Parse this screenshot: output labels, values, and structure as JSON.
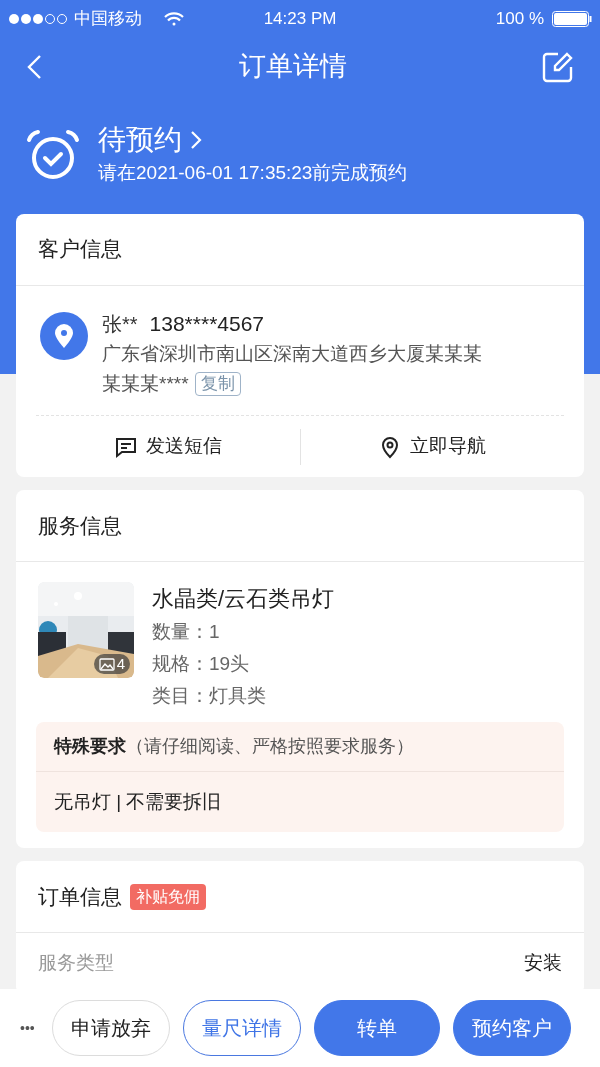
{
  "status_bar": {
    "carrier": "中国移动",
    "time": "14:23 PM",
    "battery": "100 %"
  },
  "nav": {
    "title": "订单详情"
  },
  "order_status": {
    "title": "待预约",
    "deadline": "请在2021-06-01 17:35:23前完成预约"
  },
  "customer": {
    "heading": "客户信息",
    "name": "张**",
    "phone": "138****4567",
    "address_lines": [
      "广东省深圳市南山区深南大道西乡大厦某某某",
      "某某某****"
    ],
    "copy": "复制",
    "actions": [
      {
        "kind": "sms",
        "label": "发送短信"
      },
      {
        "kind": "navigate",
        "label": "立即导航"
      }
    ]
  },
  "service": {
    "heading": "服务信息",
    "photo": {
      "count": "4"
    },
    "product": "水晶类/云石类吊灯",
    "specs": [
      {
        "label": "数量：",
        "value": "1"
      },
      {
        "label": "规格：",
        "value": "19头"
      },
      {
        "label": "类目：",
        "value": "灯具类"
      }
    ],
    "requirement_title": "特殊要求",
    "requirement_hint": "（请仔细阅读、严格按照要求服务）",
    "requirement": "无吊灯 | 不需要拆旧"
  },
  "order": {
    "heading": "订单信息",
    "tag": "补贴免佣",
    "rows": [
      {
        "label": "服务类型",
        "value": "安装"
      }
    ]
  },
  "bottom_bar": {
    "more": "•••",
    "buttons": [
      {
        "kind": "plain",
        "label": "申请放弃"
      },
      {
        "kind": "outline",
        "label": "量尺详情"
      },
      {
        "kind": "primary",
        "label": "转单"
      },
      {
        "kind": "primary",
        "label": "预约客户"
      }
    ]
  }
}
